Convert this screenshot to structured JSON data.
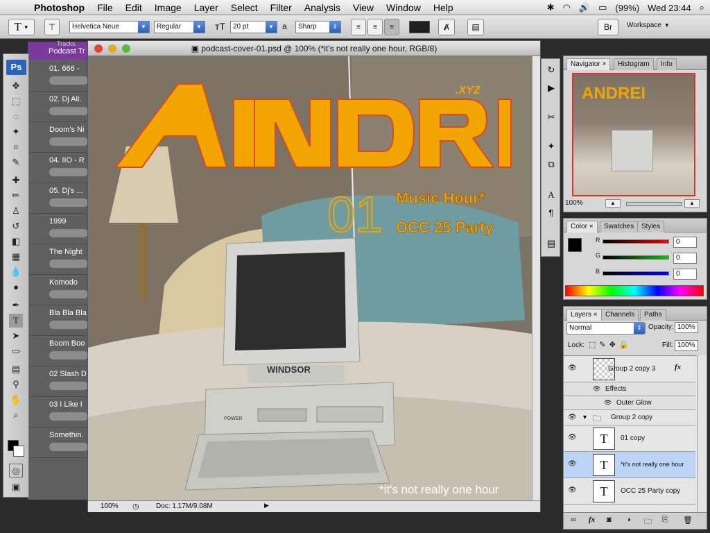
{
  "menubar": {
    "apple": "",
    "app_name": "Photoshop",
    "items": [
      "File",
      "Edit",
      "Image",
      "Layer",
      "Select",
      "Filter",
      "Analysis",
      "View",
      "Window",
      "Help"
    ],
    "battery": "(99%)",
    "clock": "Wed 23:44"
  },
  "options": {
    "tool_glyph": "T",
    "font_family": "Helvetica Neue",
    "font_style": "Regular",
    "font_size": "20 pt",
    "aa_label": "a",
    "antialias": "Sharp",
    "workspace": "Workspace"
  },
  "tracks": {
    "header": "Podcast Tr",
    "small_label": "Tracks",
    "items": [
      "01. 666 -",
      "02. Dj Ali.",
      "Doom's Ni",
      "04. IIO - R",
      "05. Dj's ...",
      "1999",
      "The Night",
      "Komodo",
      "Bla Bla Bla",
      "Boom Boo",
      "02 Slash D",
      "03 I Like I",
      "Somethin."
    ]
  },
  "toolbox": {
    "ps_logo": "Ps"
  },
  "document": {
    "title": "podcast-cover-01.psd @ 100% (*it's not really one hour, RGB/8)",
    "zoom": "100%",
    "doc_size": "Doc: 1.17M/9.08M"
  },
  "artwork": {
    "logo": "ANDREI",
    "xyz": ".XYZ",
    "episode": "01",
    "line1": "Music Hour*",
    "line2": "OCC 25 Party",
    "computer_brand": "WINDSOR",
    "power": "POWER",
    "footnote": "*it's not really one hour"
  },
  "navigator": {
    "tabs": [
      "Navigator",
      "Histogram",
      "Info"
    ],
    "zoom": "100%"
  },
  "color": {
    "tabs": [
      "Color",
      "Swatches",
      "Styles"
    ],
    "channels": [
      {
        "label": "R",
        "value": "0"
      },
      {
        "label": "G",
        "value": "0"
      },
      {
        "label": "B",
        "value": "0"
      }
    ]
  },
  "layers": {
    "tabs": [
      "Layers",
      "Channels",
      "Paths"
    ],
    "blend_mode": "Normal",
    "opacity_label": "Opacity:",
    "opacity": "100%",
    "lock_label": "Lock:",
    "fill_label": "Fill:",
    "fill": "100%",
    "items": [
      {
        "name": "Group 2 copy 3"
      },
      {
        "name": "Effects"
      },
      {
        "name": "Outer Glow"
      },
      {
        "name": "Group 2 copy"
      },
      {
        "name": "01 copy"
      },
      {
        "name": "*it's not really one hour"
      },
      {
        "name": "OCC 25 Party copy"
      }
    ]
  },
  "colors": {
    "accent": "#f2a500",
    "select": "#bcd4f6",
    "ps_blue": "#2b63b8"
  }
}
